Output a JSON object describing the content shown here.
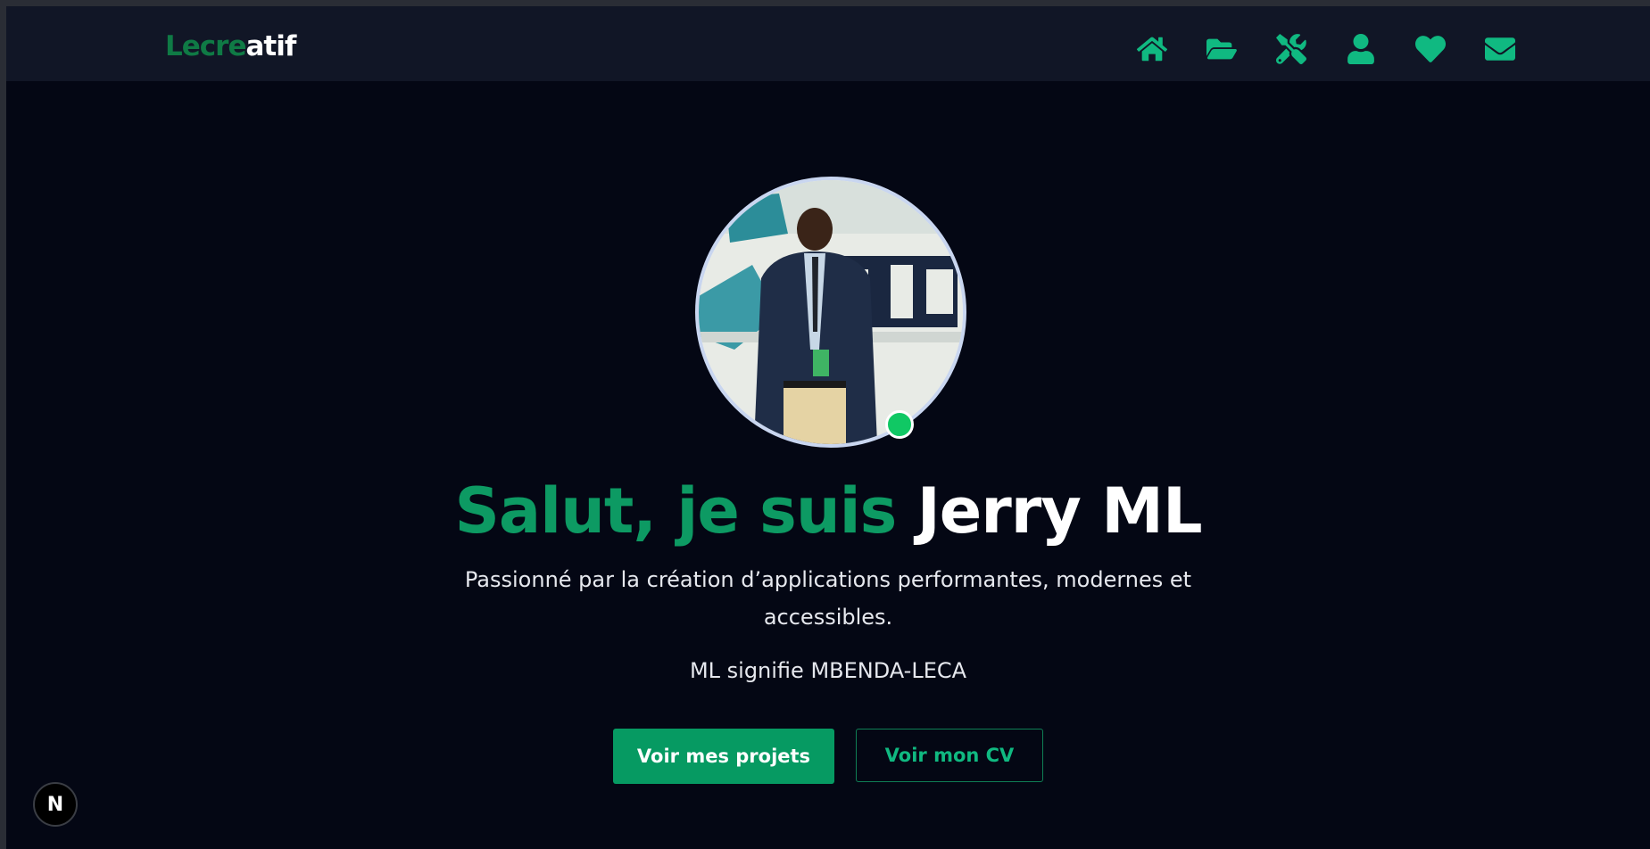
{
  "brand": {
    "logo_part1": "Lecre",
    "logo_part2": "atif",
    "accent_color": "#10b981",
    "dark_green": "#0f7a45"
  },
  "nav": {
    "items": [
      {
        "icon": "home-icon"
      },
      {
        "icon": "folder-open-icon"
      },
      {
        "icon": "tools-icon"
      },
      {
        "icon": "user-icon"
      },
      {
        "icon": "heart-icon"
      },
      {
        "icon": "envelope-icon"
      }
    ]
  },
  "hero": {
    "greeting": "Salut, je suis",
    "name": "Jerry ML",
    "subtitle": "Passionné par la création d’applications performantes, modernes et accessibles.",
    "meaning": "ML signifie MBENDA-LECA",
    "primary_button": "Voir mes projets",
    "secondary_button": "Voir mon CV",
    "status": "online"
  },
  "dev_badge": {
    "label": "N"
  }
}
